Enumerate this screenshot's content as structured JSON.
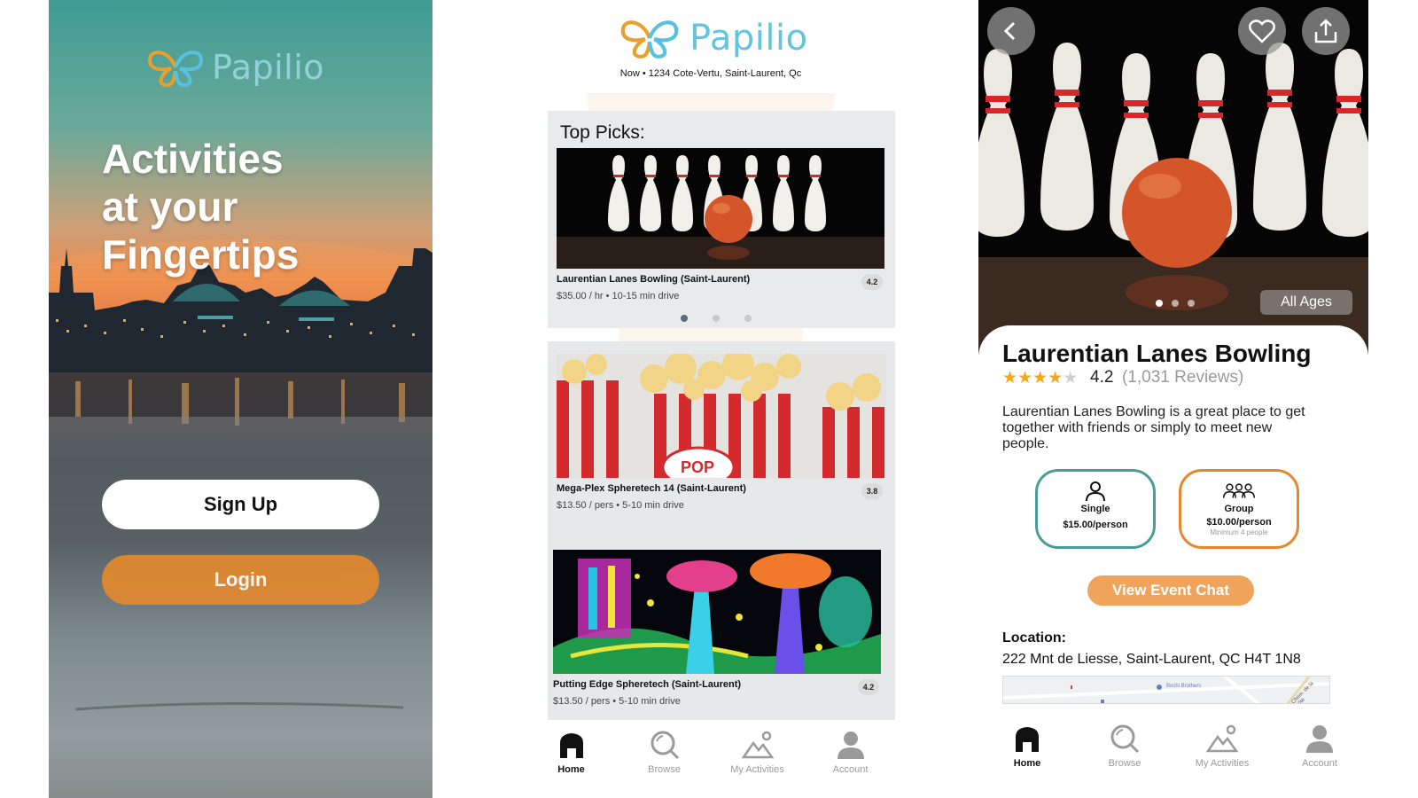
{
  "brand": {
    "name": "Papilio",
    "accent": "#64c4df",
    "wing_orange": "#e8a02e",
    "wing_blue": "#58c0e0"
  },
  "splash": {
    "headline": [
      "Activities",
      "at your",
      "Fingertips"
    ],
    "signup_label": "Sign Up",
    "login_label": "Login",
    "login_color": "#e3892e"
  },
  "home": {
    "location_line": "Now • 1234 Cote-Vertu, Saint-Laurent, Qc",
    "top_picks_title": "Top Picks:",
    "carousel": {
      "count": 3,
      "active": 1
    },
    "cards": [
      {
        "name": "Laurentian Lanes Bowling (Saint-Laurent)",
        "meta": "$35.00 / hr • 10-15 min drive",
        "rating": "4.2",
        "image": "bowling-pins-image"
      },
      {
        "name": "Mega-Plex Spheretech 14 (Saint-Laurent)",
        "meta": "$13.50 / pers • 5-10 min drive",
        "rating": "3.8",
        "image": "popcorn-image"
      },
      {
        "name": "Putting Edge Spheretech (Saint-Laurent)",
        "meta": "$13.50 / pers • 5-10 min drive",
        "rating": "4.2",
        "image": "glow-minigolf-image"
      }
    ]
  },
  "nav": [
    {
      "label": "Home",
      "icon": "home-icon"
    },
    {
      "label": "Browse",
      "icon": "browse-icon"
    },
    {
      "label": "My Activities",
      "icon": "my-activities-icon"
    },
    {
      "label": "Account",
      "icon": "account-icon"
    }
  ],
  "detail": {
    "title": "Laurentian Lanes Bowling",
    "rating": "4.2",
    "rating_value": 4.2,
    "reviews": "(1,031 Reviews)",
    "ages": "All Ages",
    "description": "Laurentian Lanes Bowling is a great place to get together with friends or simply to meet new people.",
    "pricing": {
      "single": {
        "label": "Single",
        "price": "$15.00/person",
        "border": "#4a9c99"
      },
      "group": {
        "label": "Group",
        "price": "$10.00/person",
        "note": "Minimum 4 people",
        "border": "#e8862e"
      }
    },
    "chat_label": "View Event Chat",
    "location_label": "Location:",
    "address": "222 Mnt de Liesse, Saint-Laurent, QC H4T 1N8",
    "map_labels": [
      "Bochi Brothers",
      "Chem. de la Côte"
    ],
    "hero_dots": {
      "count": 3,
      "active": 1
    }
  }
}
